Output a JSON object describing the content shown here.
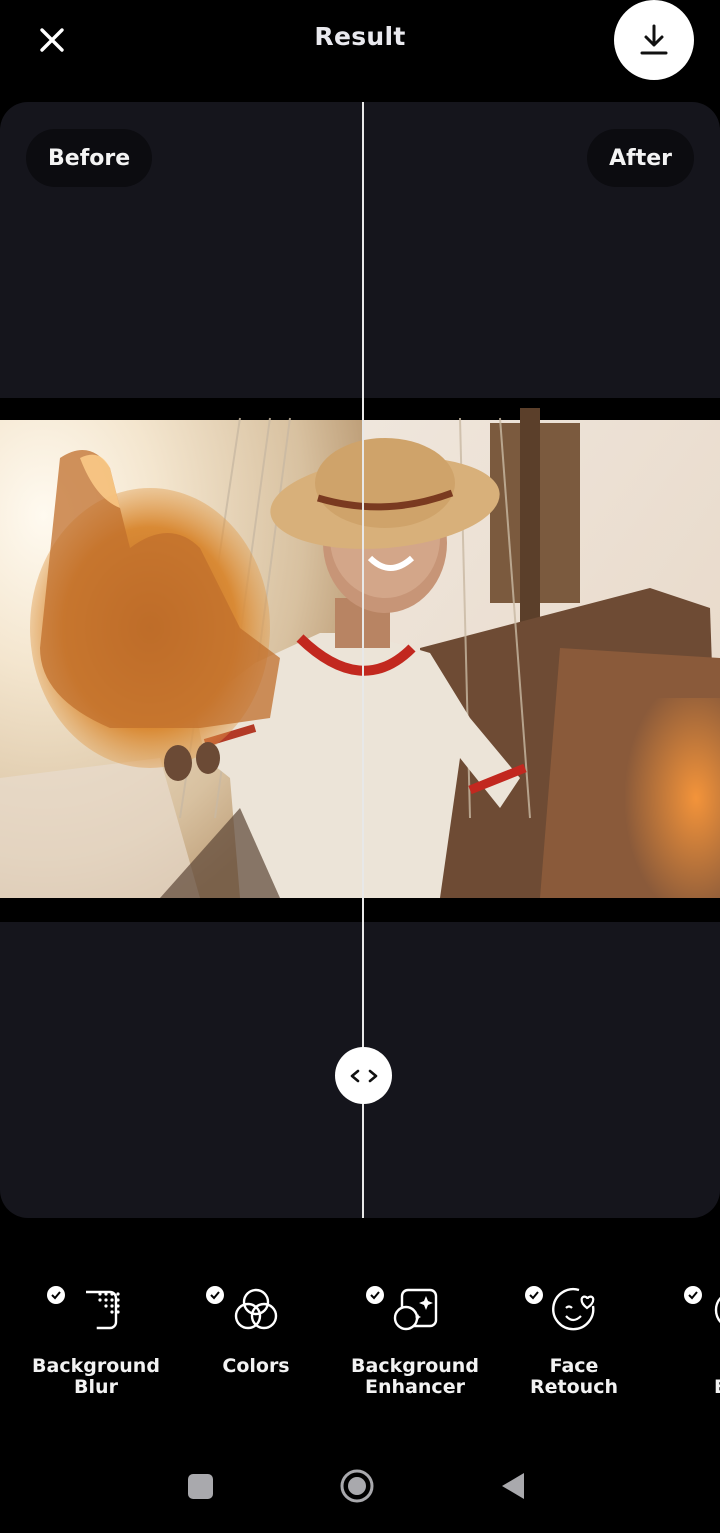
{
  "header": {
    "title": "Result",
    "close_icon": "close-icon",
    "download_icon": "download-icon"
  },
  "compare": {
    "before_label": "Before",
    "after_label": "After",
    "handle_icon": "left-right-arrows-icon"
  },
  "tools": [
    {
      "label": "Background\nBlur",
      "icon": "background-blur-icon",
      "checked": true
    },
    {
      "label": "Colors",
      "icon": "colors-icon",
      "checked": true
    },
    {
      "label": "Background\nEnhancer",
      "icon": "background-enhancer-icon",
      "checked": true
    },
    {
      "label": "Face\nRetouch",
      "icon": "face-retouch-icon",
      "checked": true
    },
    {
      "label": "F\nEnh",
      "icon": "face-enhancer-icon",
      "checked": true
    }
  ],
  "navigation": {
    "recents_icon": "square-icon",
    "home_icon": "circle-icon",
    "back_icon": "triangle-back-icon"
  },
  "colors": {
    "background": "#000000",
    "panel": "#15151c",
    "pill": "#0c0c10",
    "white": "#ffffff"
  }
}
